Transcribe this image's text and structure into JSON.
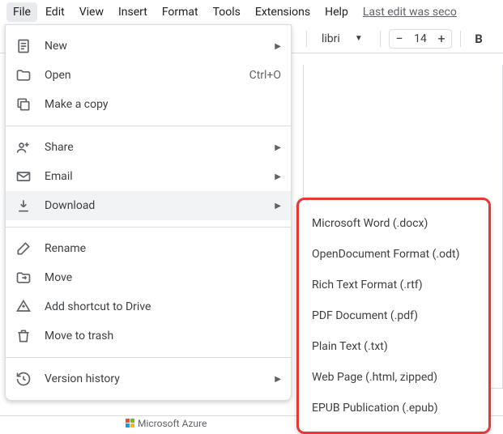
{
  "menubar": {
    "items": [
      "File",
      "Edit",
      "View",
      "Insert",
      "Format",
      "Tools",
      "Extensions",
      "Help"
    ],
    "status": "Last edit was seco"
  },
  "toolbar": {
    "font": "libri",
    "fontSize": "14",
    "minus": "−",
    "plus": "+",
    "bold": "B"
  },
  "fileMenu": {
    "new": "New",
    "open": "Open",
    "open_shortcut": "Ctrl+O",
    "make_copy": "Make a copy",
    "share": "Share",
    "email": "Email",
    "download": "Download",
    "rename": "Rename",
    "move": "Move",
    "add_shortcut": "Add shortcut to Drive",
    "move_trash": "Move to trash",
    "version_history": "Version history"
  },
  "downloadSubmenu": [
    "Microsoft Word (.docx)",
    "OpenDocument Format (.odt)",
    "Rich Text Format (.rtf)",
    "PDF Document (.pdf)",
    "Plain Text (.txt)",
    "Web Page (.html, zipped)",
    "EPUB Publication (.epub)"
  ],
  "footer": {
    "azure": "Microsoft Azure"
  }
}
